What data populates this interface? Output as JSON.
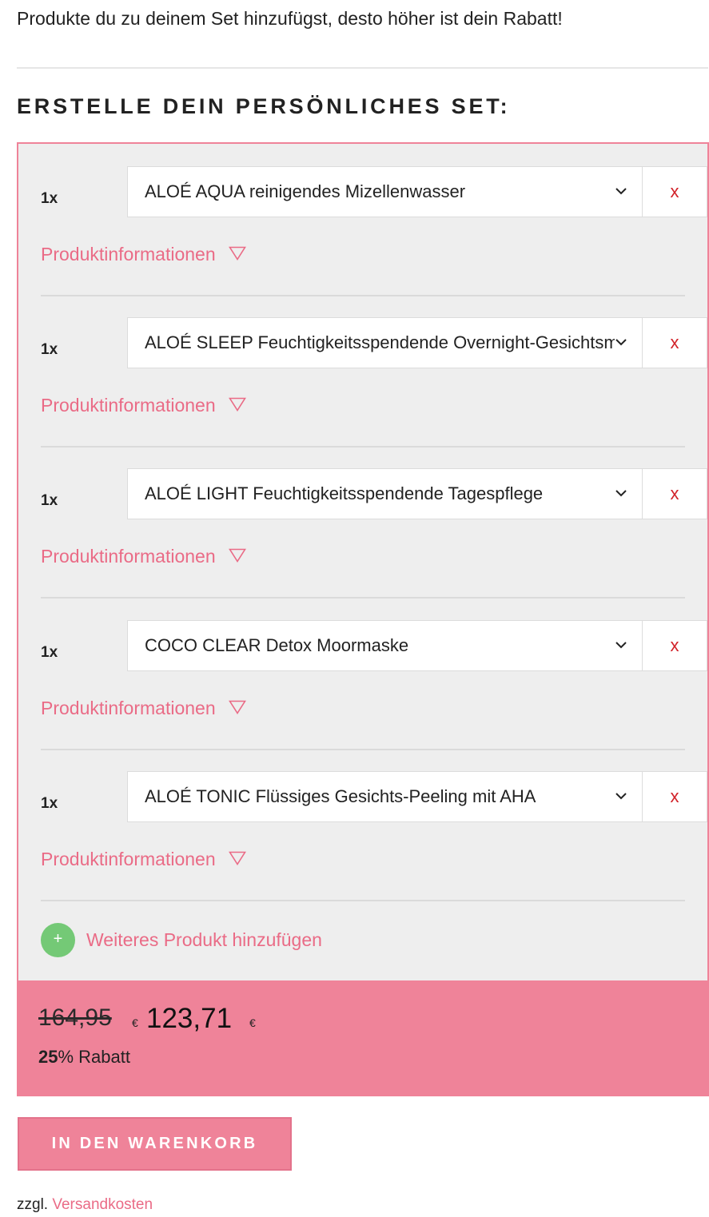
{
  "intro_text": "Produkte du zu deinem Set hinzufügst, desto höher ist dein Rabatt!",
  "heading": "ERSTELLE DEIN PERSÖNLICHES SET:",
  "items": [
    {
      "qty": "1x",
      "product": "ALOÉ AQUA reinigendes Mizellenwasser",
      "remove_label": "x",
      "info_label": "Produktinformationen"
    },
    {
      "qty": "1x",
      "product": "ALOÉ SLEEP Feuchtigkeitsspendende Overnight-Gesichtsmaske",
      "remove_label": "x",
      "info_label": "Produktinformationen"
    },
    {
      "qty": "1x",
      "product": "ALOÉ LIGHT Feuchtigkeitsspendende Tagespflege",
      "remove_label": "x",
      "info_label": "Produktinformationen"
    },
    {
      "qty": "1x",
      "product": "COCO CLEAR Detox Moormaske",
      "remove_label": "x",
      "info_label": "Produktinformationen"
    },
    {
      "qty": "1x",
      "product": "ALOÉ TONIC Flüssiges Gesichts-Peeling mit AHA",
      "remove_label": "x",
      "info_label": "Produktinformationen"
    }
  ],
  "add_product": {
    "icon": "plus-icon",
    "label": "Weiteres Produkt hinzufügen"
  },
  "price": {
    "old": "164,95",
    "new": "123,71",
    "currency": "€",
    "discount_percent": "25",
    "discount_suffix": "% Rabatt"
  },
  "cart_button": "IN DEN WARENKORB",
  "shipping": {
    "prefix": "zzgl.",
    "link": "Versandkosten"
  },
  "colors": {
    "accent_pink": "#ef8399",
    "link_pink": "#ea6b86",
    "remove_red": "#d2232a",
    "add_green": "#74c976",
    "panel_grey": "#eeeeee"
  }
}
